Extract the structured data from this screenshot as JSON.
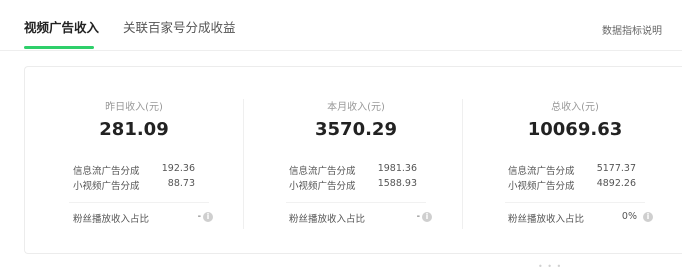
{
  "tabs": {
    "active": "视频广告收入",
    "inactive": "关联百家号分成收益"
  },
  "help_link": "数据指标说明",
  "colors": {
    "accent": "#2ecf6a"
  },
  "columns": [
    {
      "label": "昨日收入(元)",
      "value": "281.09",
      "rows": [
        {
          "label": "信息流广告分成",
          "value": "192.36"
        },
        {
          "label": "小视频广告分成",
          "value": "88.73"
        }
      ],
      "fan_label": "粉丝播放收入占比",
      "fan_value": "-",
      "info_icon": "info-icon"
    },
    {
      "label": "本月收入(元)",
      "value": "3570.29",
      "rows": [
        {
          "label": "信息流广告分成",
          "value": "1981.36"
        },
        {
          "label": "小视频广告分成",
          "value": "1588.93"
        }
      ],
      "fan_label": "粉丝播放收入占比",
      "fan_value": "-",
      "info_icon": "info-icon"
    },
    {
      "label": "总收入(元)",
      "value": "10069.63",
      "rows": [
        {
          "label": "信息流广告分成",
          "value": "5177.37"
        },
        {
          "label": "小视频广告分成",
          "value": "4892.26"
        }
      ],
      "fan_label": "粉丝播放收入占比",
      "fan_value": "0%",
      "info_icon": "info-icon"
    }
  ]
}
